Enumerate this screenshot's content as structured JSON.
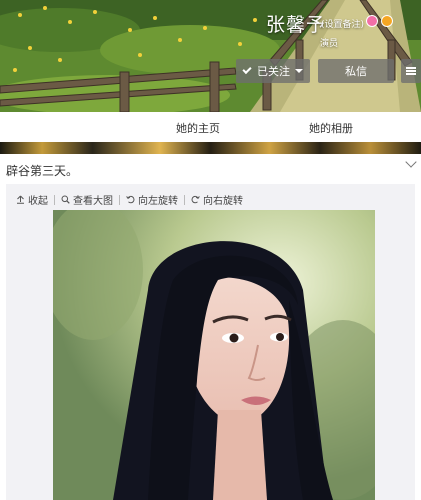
{
  "profile": {
    "name": "张馨予",
    "remark_link": "(设置备注)",
    "verified_title": "演员",
    "follow_button": "已关注",
    "message_button": "私信"
  },
  "tabs": [
    {
      "label": "她的主页"
    },
    {
      "label": "她的相册"
    }
  ],
  "post": {
    "text": "辟谷第三天。",
    "toolbar": {
      "collapse": "收起",
      "view_large": "查看大图",
      "rotate_left": "向左旋转",
      "rotate_right": "向右旋转"
    }
  },
  "colors": {
    "button_bg": "#6e6e6e",
    "badge_pink": "#f26fa7",
    "badge_gold": "#f5a623"
  },
  "icons": [
    "collapse-up-icon",
    "magnifier-icon",
    "rotate-left-icon",
    "rotate-right-icon",
    "check-icon",
    "caret-down-icon",
    "hamburger-menu-icon",
    "chevron-down-icon"
  ]
}
